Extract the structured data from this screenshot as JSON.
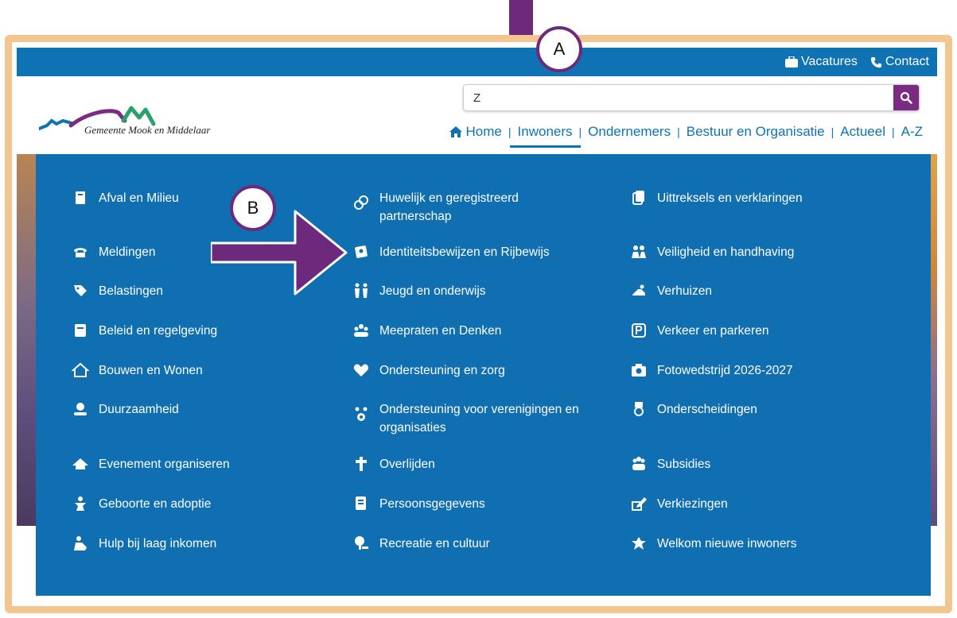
{
  "topbar": {
    "vacatures": "Vacatures",
    "contact": "Contact"
  },
  "logo": {
    "name": "Gemeente Mook en Middelaar"
  },
  "search": {
    "value": "Z",
    "placeholder": ""
  },
  "nav": {
    "items": [
      "Home",
      "Inwoners",
      "Ondernemers",
      "Bestuur en Organisatie",
      "Actueel",
      "A-Z"
    ],
    "active": "Inwoners"
  },
  "menu": {
    "col1": [
      {
        "label": "Afval en Milieu",
        "icon": "trash-icon"
      },
      {
        "label": "Meldingen",
        "icon": "phone-icon"
      },
      {
        "label": "Belastingen",
        "icon": "tag-icon"
      },
      {
        "label": "Beleid en regelgeving",
        "icon": "document-icon"
      },
      {
        "label": "Bouwen en Wonen",
        "icon": "house-icon"
      },
      {
        "label": "Duurzaamheid",
        "icon": "globe-hand-icon"
      },
      {
        "label": "Evenement organiseren",
        "icon": "tent-icon"
      },
      {
        "label": "Geboorte en adoptie",
        "icon": "baby-icon"
      },
      {
        "label": "Hulp bij laag inkomen",
        "icon": "help-hand-icon"
      }
    ],
    "col2": [
      {
        "label": "Huwelijk en geregistreerd partnerschap",
        "icon": "rings-icon"
      },
      {
        "label": "Identiteitsbewijzen en Rijbewijs",
        "icon": "id-card-icon"
      },
      {
        "label": "Jeugd en onderwijs",
        "icon": "children-icon"
      },
      {
        "label": "Meepraten en Denken",
        "icon": "group-icon"
      },
      {
        "label": "Ondersteuning en zorg",
        "icon": "heart-icon"
      },
      {
        "label": "Ondersteuning voor verenigingen en organisaties",
        "icon": "people-gear-icon"
      },
      {
        "label": "Overlijden",
        "icon": "cross-icon"
      },
      {
        "label": "Persoonsgegevens",
        "icon": "file-list-icon"
      },
      {
        "label": "Recreatie en cultuur",
        "icon": "tree-icon"
      }
    ],
    "col3": [
      {
        "label": "Uittreksels en verklaringen",
        "icon": "copy-icon"
      },
      {
        "label": "Veiligheid en handhaving",
        "icon": "police-icon"
      },
      {
        "label": "Verhuizen",
        "icon": "moving-icon"
      },
      {
        "label": "Verkeer en parkeren",
        "icon": "parking-icon"
      },
      {
        "label": "Fotowedstrijd 2026-2027",
        "icon": "camera-icon"
      },
      {
        "label": "Onderscheidingen",
        "icon": "medal-icon"
      },
      {
        "label": "Subsidies",
        "icon": "people-icon"
      },
      {
        "label": "Verkiezingen",
        "icon": "pen-icon"
      },
      {
        "label": "Welkom nieuwe inwoners",
        "icon": "welcome-icon"
      }
    ]
  },
  "annotations": {
    "a": "A",
    "b": "B"
  },
  "colors": {
    "primary": "#0f72b3",
    "accent": "#7b2b82",
    "frame": "#f3c68f"
  }
}
